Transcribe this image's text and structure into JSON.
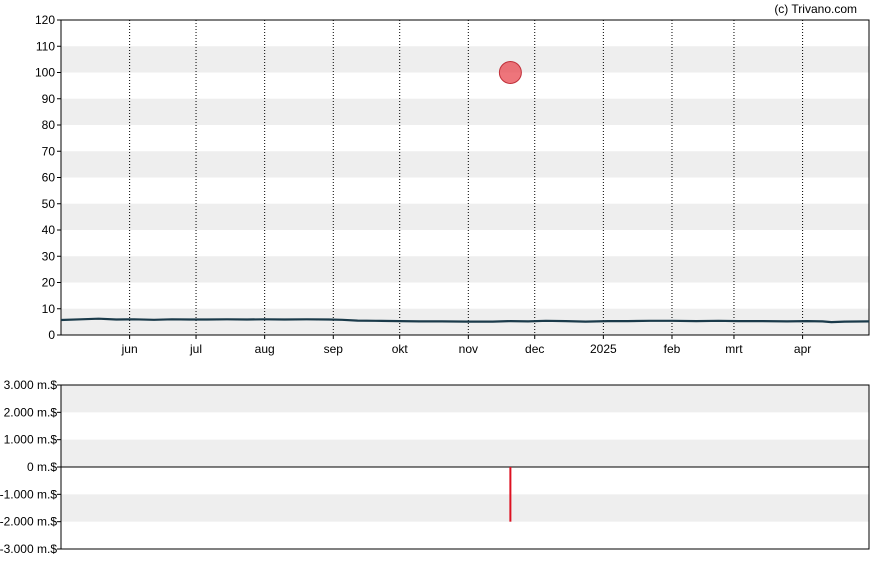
{
  "credit": "(c) Trivano.com",
  "colors": {
    "band": "#eeeeee",
    "price_line": "#1a3a4a",
    "event_marker": "#e8474f",
    "event_bar": "#dd1122",
    "grid_vertical": "#000000",
    "zero_line": "#000000"
  },
  "chart_data": [
    {
      "type": "line",
      "title": "",
      "xlabel": "",
      "ylabel": "",
      "ylim": [
        0,
        120
      ],
      "y_ticks": [
        "0",
        "10",
        "20",
        "30",
        "40",
        "50",
        "60",
        "70",
        "80",
        "90",
        "100",
        "110",
        "120"
      ],
      "x_ticks": [
        {
          "label": "jun",
          "date": "2024-06-01"
        },
        {
          "label": "jul",
          "date": "2024-07-01"
        },
        {
          "label": "aug",
          "date": "2024-08-01"
        },
        {
          "label": "sep",
          "date": "2024-09-01"
        },
        {
          "label": "okt",
          "date": "2024-10-01"
        },
        {
          "label": "nov",
          "date": "2024-11-01"
        },
        {
          "label": "dec",
          "date": "2024-12-01"
        },
        {
          "label": "2025",
          "date": "2025-01-01"
        },
        {
          "label": "feb",
          "date": "2025-02-01"
        },
        {
          "label": "mrt",
          "date": "2025-03-01"
        },
        {
          "label": "apr",
          "date": "2025-04-01"
        }
      ],
      "xlim": [
        "2024-05-01",
        "2025-05-01"
      ],
      "grid": "dotted vertical at month ticks, alternating horizontal bands",
      "series": [
        {
          "points": [
            [
              "2024-05-01",
              5.7
            ],
            [
              "2024-05-10",
              6.0
            ],
            [
              "2024-05-18",
              6.2
            ],
            [
              "2024-05-26",
              5.9
            ],
            [
              "2024-06-03",
              6.0
            ],
            [
              "2024-06-12",
              5.8
            ],
            [
              "2024-06-20",
              6.0
            ],
            [
              "2024-06-28",
              5.9
            ],
            [
              "2024-07-06",
              5.9
            ],
            [
              "2024-07-15",
              6.0
            ],
            [
              "2024-07-24",
              5.9
            ],
            [
              "2024-08-01",
              6.0
            ],
            [
              "2024-08-10",
              5.9
            ],
            [
              "2024-08-20",
              6.0
            ],
            [
              "2024-08-30",
              5.9
            ],
            [
              "2024-09-05",
              5.8
            ],
            [
              "2024-09-12",
              5.5
            ],
            [
              "2024-09-20",
              5.4
            ],
            [
              "2024-10-01",
              5.3
            ],
            [
              "2024-10-10",
              5.2
            ],
            [
              "2024-10-20",
              5.2
            ],
            [
              "2024-11-01",
              5.1
            ],
            [
              "2024-11-12",
              5.1
            ],
            [
              "2024-11-20",
              5.3
            ],
            [
              "2024-11-28",
              5.2
            ],
            [
              "2024-12-06",
              5.4
            ],
            [
              "2024-12-15",
              5.3
            ],
            [
              "2024-12-24",
              5.1
            ],
            [
              "2025-01-03",
              5.3
            ],
            [
              "2025-01-12",
              5.3
            ],
            [
              "2025-01-22",
              5.4
            ],
            [
              "2025-02-01",
              5.4
            ],
            [
              "2025-02-12",
              5.3
            ],
            [
              "2025-02-22",
              5.4
            ],
            [
              "2025-03-03",
              5.3
            ],
            [
              "2025-03-14",
              5.3
            ],
            [
              "2025-03-25",
              5.2
            ],
            [
              "2025-04-03",
              5.3
            ],
            [
              "2025-04-10",
              5.2
            ],
            [
              "2025-04-14",
              4.9
            ],
            [
              "2025-04-20",
              5.1
            ],
            [
              "2025-05-01",
              5.2
            ]
          ]
        }
      ],
      "markers": [
        {
          "date": "2024-11-20",
          "value": 100
        }
      ]
    },
    {
      "type": "bar",
      "title": "",
      "xlabel": "",
      "ylabel": "",
      "ylim": [
        -3000,
        3000
      ],
      "y_ticks": [
        "-3.000 m.$",
        "-2.000 m.$",
        "-1.000 m.$",
        "0 m.$",
        "1.000 m.$",
        "2.000 m.$",
        "3.000 m.$"
      ],
      "xlim": [
        "2024-05-01",
        "2025-05-01"
      ],
      "grid": "alternating horizontal bands",
      "bars": [
        {
          "date": "2024-11-20",
          "value": -2000
        }
      ]
    }
  ]
}
